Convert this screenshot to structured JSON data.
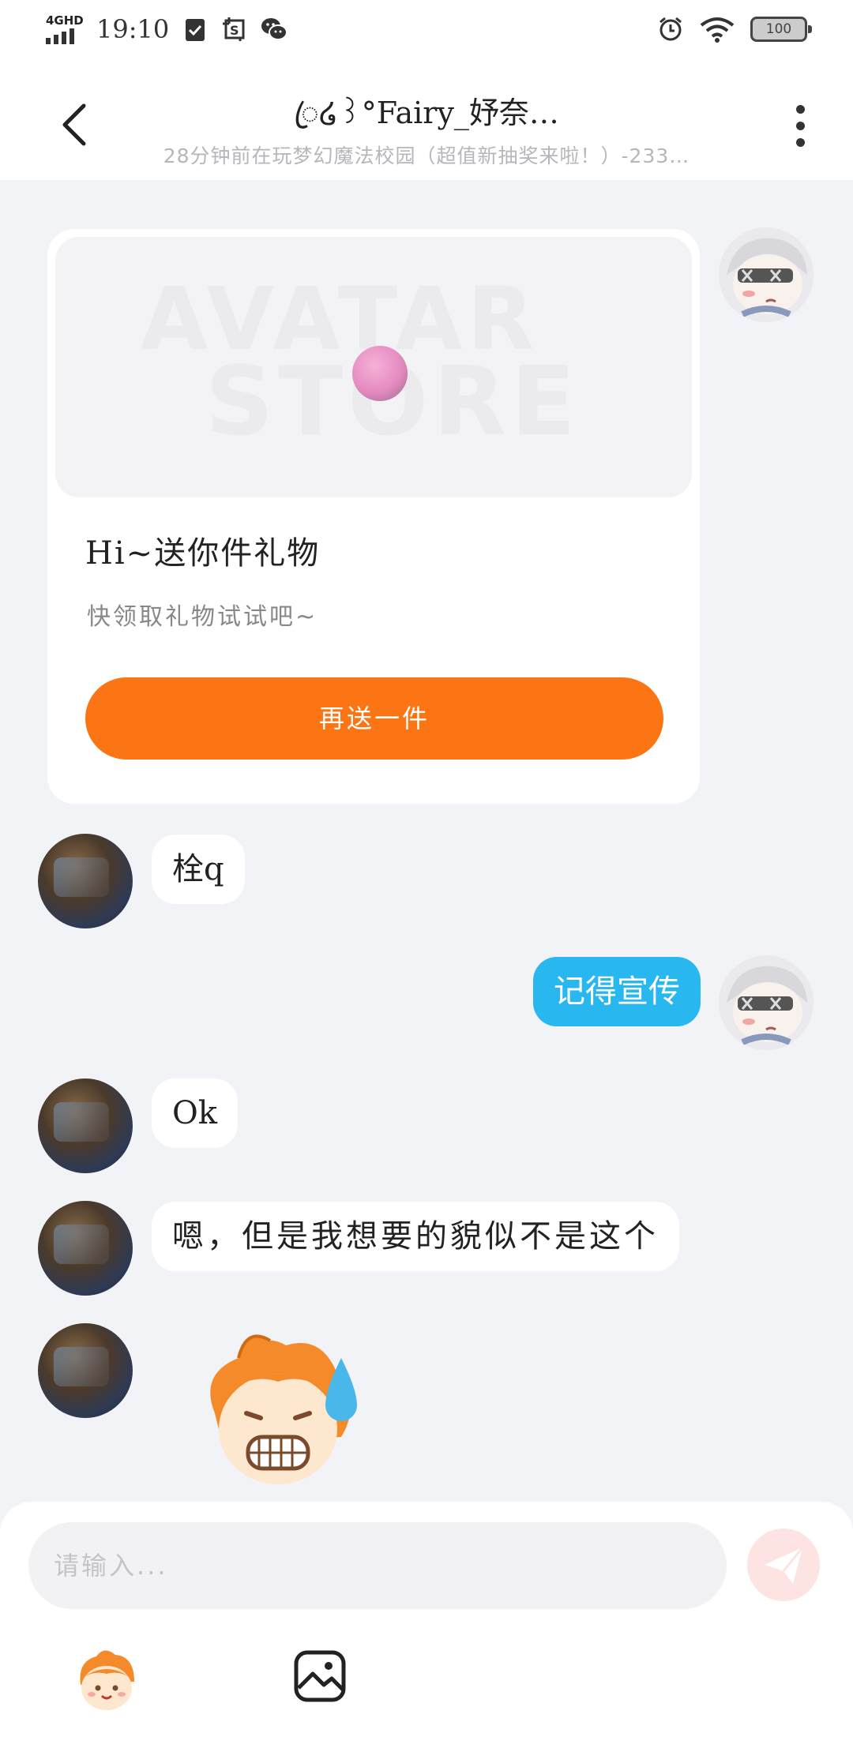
{
  "status_bar": {
    "network": "4GHD",
    "time": "19:10",
    "battery": "100"
  },
  "header": {
    "title": "ꦿ໒꒱°Fairy_妤奈…",
    "subtitle": "28分钟前在玩梦幻魔法校园（超值新抽奖来啦！）-233…"
  },
  "gift_card": {
    "watermark_line1": "AVATAR",
    "watermark_line2": "STORE",
    "title": "Hi~送你件礼物",
    "description": "快领取礼物试试吧~",
    "button_label": "再送一件"
  },
  "messages": [
    {
      "sender": "other",
      "text": "栓q"
    },
    {
      "sender": "me",
      "text": "记得宣传"
    },
    {
      "sender": "other",
      "text": "Ok"
    },
    {
      "sender": "other",
      "text": "嗯，但是我想要的貌似不是这个"
    },
    {
      "sender": "other",
      "type": "sticker",
      "sticker": "sweating-grimace-sticker"
    }
  ],
  "input": {
    "placeholder": "请输入..."
  },
  "colors": {
    "accent_orange": "#fb7514",
    "my_bubble": "#29b7f0",
    "background": "#f2f3f7"
  },
  "icons": [
    "back-arrow-icon",
    "more-vertical-icon",
    "send-plane-icon",
    "emoji-sticker-icon",
    "image-icon",
    "alarm-icon",
    "wifi-icon",
    "wechat-icon"
  ]
}
